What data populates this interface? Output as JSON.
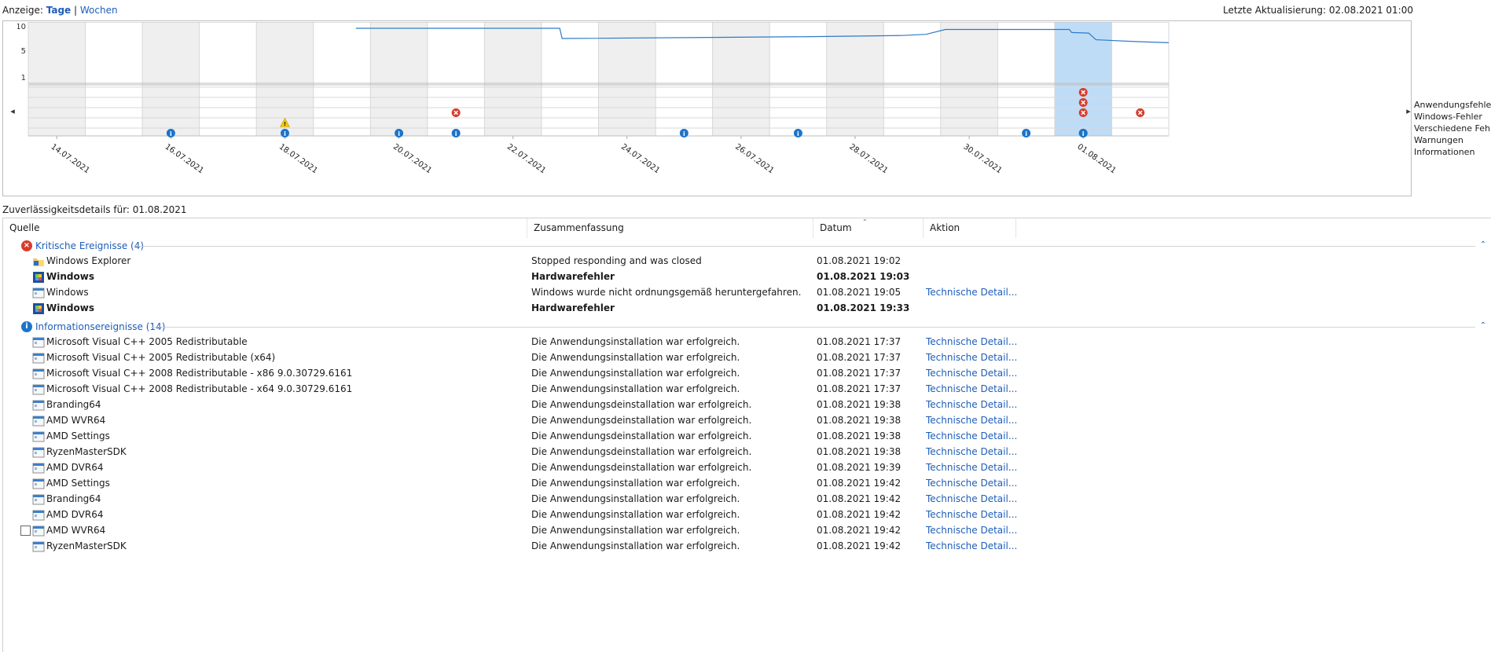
{
  "top_bar": {
    "view_prefix": "Anzeige:",
    "view_days": "Tage",
    "view_sep": "|",
    "view_weeks": "Wochen",
    "last_update": "Letzte Aktualisierung: 02.08.2021 01:00"
  },
  "chart_data": {
    "type": "line",
    "title": "",
    "xlabel": "",
    "ylabel": "",
    "ylim": [
      1,
      10
    ],
    "y_ticks": [
      "10",
      "5",
      "1"
    ],
    "categories": [
      "14.07.2021",
      "15.07.2021",
      "16.07.2021",
      "17.07.2021",
      "18.07.2021",
      "19.07.2021",
      "20.07.2021",
      "21.07.2021",
      "22.07.2021",
      "23.07.2021",
      "24.07.2021",
      "25.07.2021",
      "26.07.2021",
      "27.07.2021",
      "28.07.2021",
      "29.07.2021",
      "30.07.2021",
      "31.07.2021",
      "01.08.2021",
      "02.08.2021"
    ],
    "x_tick_labels": [
      "14.07.2021",
      "16.07.2021",
      "18.07.2021",
      "20.07.2021",
      "22.07.2021",
      "24.07.2021",
      "26.07.2021",
      "28.07.2021",
      "30.07.2021",
      "01.08.2021"
    ],
    "selected_category": "01.08.2021",
    "series": [
      {
        "values": [
          [
            13.5,
            10
          ],
          [
            21.9,
            10
          ],
          [
            22.0,
            8.3
          ],
          [
            32.0,
            8.6
          ],
          [
            36.0,
            8.8
          ],
          [
            37.0,
            9.0
          ],
          [
            37.8,
            9.8
          ],
          [
            42.9,
            9.8
          ],
          [
            43.0,
            9.3
          ],
          [
            43.7,
            9.2
          ],
          [
            44.0,
            8.1
          ],
          [
            45.6,
            7.8
          ],
          [
            47.0,
            7.6
          ]
        ]
      }
    ],
    "event_rows": [
      {
        "label": "Anwendungsfehler",
        "type": "error",
        "days": [
          "01.08.2021"
        ]
      },
      {
        "label": "Windows-Fehler",
        "type": "error",
        "days": [
          "01.08.2021"
        ]
      },
      {
        "label": "Verschiedene Fehler",
        "type": "error",
        "days": [
          "21.07.2021",
          "01.08.2021",
          "02.08.2021"
        ]
      },
      {
        "label": "Warnungen",
        "type": "warning",
        "days": [
          "18.07.2021"
        ]
      },
      {
        "label": "Informationen",
        "type": "info",
        "days": [
          "16.07.2021",
          "18.07.2021",
          "20.07.2021",
          "21.07.2021",
          "25.07.2021",
          "27.07.2021",
          "31.07.2021",
          "31.07.2021b",
          "01.08.2021"
        ]
      }
    ],
    "colors": {
      "line": "#2d7ac8",
      "grid": "#d7d7d7",
      "weekend": "#efefef",
      "selected": "#bfdcf7",
      "error": "#d73c2c",
      "info": "#1d74c9",
      "warning": "#f2c811"
    }
  },
  "legend": {
    "items": [
      "Anwendungsfehler",
      "Windows-Fehler",
      "Verschiedene Fehler",
      "Warnungen",
      "Informationen"
    ]
  },
  "details": {
    "label": "Zuverlässigkeitsdetails für: 01.08.2021"
  },
  "table": {
    "headers": {
      "source": "Quelle",
      "summary": "Zusammenfassung",
      "date": "Datum",
      "action": "Aktion"
    },
    "critical": {
      "title": "Kritische Ereignisse (4)",
      "rows": [
        {
          "source": "Windows Explorer",
          "summary": "Stopped responding and was closed",
          "date": "01.08.2021 19:02",
          "action": "",
          "bold": false,
          "icon": "folder-icon"
        },
        {
          "source": "Windows",
          "summary": "Hardwarefehler",
          "date": "01.08.2021 19:03",
          "action": "",
          "bold": true,
          "icon": "windows-shield-icon"
        },
        {
          "source": "Windows",
          "summary": "Windows wurde nicht ordnungsgemäß heruntergefahren.",
          "date": "01.08.2021 19:05",
          "action": "Technische Detail...",
          "bold": false,
          "icon": "app-window-icon"
        },
        {
          "source": "Windows",
          "summary": "Hardwarefehler",
          "date": "01.08.2021 19:33",
          "action": "",
          "bold": true,
          "icon": "windows-shield-icon"
        }
      ]
    },
    "info": {
      "title": "Informationsereignisse (14)",
      "rows": [
        {
          "source": "Microsoft Visual C++ 2005 Redistributable",
          "summary": "Die Anwendungsinstallation war erfolgreich.",
          "date": "01.08.2021 17:37",
          "action": "Technische Detail..."
        },
        {
          "source": "Microsoft Visual C++ 2005 Redistributable (x64)",
          "summary": "Die Anwendungsinstallation war erfolgreich.",
          "date": "01.08.2021 17:37",
          "action": "Technische Detail..."
        },
        {
          "source": "Microsoft Visual C++ 2008 Redistributable - x86 9.0.30729.6161",
          "summary": "Die Anwendungsinstallation war erfolgreich.",
          "date": "01.08.2021 17:37",
          "action": "Technische Detail..."
        },
        {
          "source": "Microsoft Visual C++ 2008 Redistributable - x64 9.0.30729.6161",
          "summary": "Die Anwendungsinstallation war erfolgreich.",
          "date": "01.08.2021 17:37",
          "action": "Technische Detail..."
        },
        {
          "source": "Branding64",
          "summary": "Die Anwendungsdeinstallation war erfolgreich.",
          "date": "01.08.2021 19:38",
          "action": "Technische Detail..."
        },
        {
          "source": "AMD WVR64",
          "summary": "Die Anwendungsdeinstallation war erfolgreich.",
          "date": "01.08.2021 19:38",
          "action": "Technische Detail..."
        },
        {
          "source": "AMD Settings",
          "summary": "Die Anwendungsdeinstallation war erfolgreich.",
          "date": "01.08.2021 19:38",
          "action": "Technische Detail..."
        },
        {
          "source": "RyzenMasterSDK",
          "summary": "Die Anwendungsdeinstallation war erfolgreich.",
          "date": "01.08.2021 19:38",
          "action": "Technische Detail..."
        },
        {
          "source": "AMD DVR64",
          "summary": "Die Anwendungsdeinstallation war erfolgreich.",
          "date": "01.08.2021 19:39",
          "action": "Technische Detail..."
        },
        {
          "source": "AMD Settings",
          "summary": "Die Anwendungsinstallation war erfolgreich.",
          "date": "01.08.2021 19:42",
          "action": "Technische Detail..."
        },
        {
          "source": "Branding64",
          "summary": "Die Anwendungsinstallation war erfolgreich.",
          "date": "01.08.2021 19:42",
          "action": "Technische Detail..."
        },
        {
          "source": "AMD DVR64",
          "summary": "Die Anwendungsinstallation war erfolgreich.",
          "date": "01.08.2021 19:42",
          "action": "Technische Detail..."
        },
        {
          "source": "AMD WVR64",
          "summary": "Die Anwendungsinstallation war erfolgreich.",
          "date": "01.08.2021 19:42",
          "action": "Technische Detail..."
        },
        {
          "source": "RyzenMasterSDK",
          "summary": "Die Anwendungsinstallation war erfolgreich.",
          "date": "01.08.2021 19:42",
          "action": "Technische Detail..."
        }
      ]
    }
  }
}
